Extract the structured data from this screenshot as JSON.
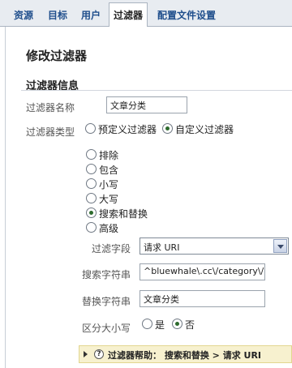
{
  "tabs": [
    {
      "label": "资源"
    },
    {
      "label": "目标"
    },
    {
      "label": "用户"
    },
    {
      "label": "过滤器",
      "active": true
    },
    {
      "label": "配置文件设置"
    }
  ],
  "page": {
    "title": "修改过滤器",
    "section_title": "过滤器信息"
  },
  "form": {
    "filter_name": {
      "label": "过滤器名称",
      "value": "文章分类"
    },
    "filter_type": {
      "label": "过滤器类型",
      "options": [
        {
          "label": "预定义过滤器",
          "selected": false
        },
        {
          "label": "自定义过滤器",
          "selected": true
        }
      ]
    },
    "custom_options": [
      {
        "label": "排除",
        "selected": false
      },
      {
        "label": "包含",
        "selected": false
      },
      {
        "label": "小写",
        "selected": false
      },
      {
        "label": "大写",
        "selected": false
      },
      {
        "label": "搜索和替换",
        "selected": true
      },
      {
        "label": "高级",
        "selected": false
      }
    ],
    "filter_field": {
      "label": "过滤字段",
      "value": "请求 URI"
    },
    "search_string": {
      "label": "搜索字符串",
      "value": "^bluewhale\\.cc\\/category\\/.*"
    },
    "replace_string": {
      "label": "替换字符串",
      "value": "文章分类"
    },
    "case_sensitive": {
      "label": "区分大小写",
      "options": [
        {
          "label": "是",
          "selected": false
        },
        {
          "label": "否",
          "selected": true
        }
      ]
    }
  },
  "help": {
    "text": "过滤器帮助： 搜索和替换 > 请求 URI",
    "icon": "?"
  }
}
